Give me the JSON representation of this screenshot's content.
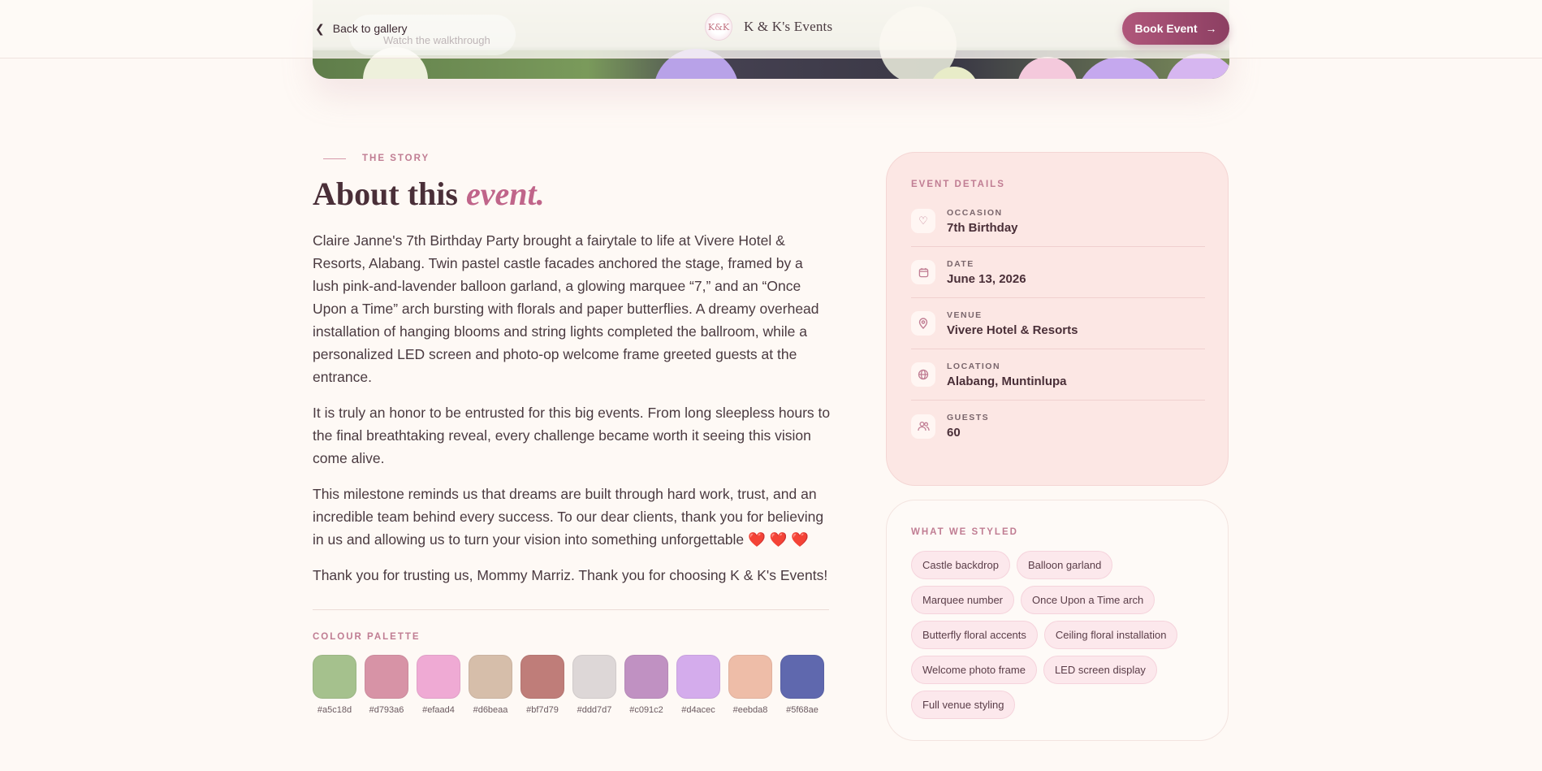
{
  "header": {
    "back_label": "Back to gallery",
    "ghost_search": "Watch the walkthrough",
    "brand_name": "K & K's Events",
    "brand_logo_text": "K&K",
    "book_label": "Book Event"
  },
  "story": {
    "eyebrow": "THE STORY",
    "title_main": "About this ",
    "title_em": "event.",
    "paragraphs": [
      "Claire Janne's 7th Birthday Party brought a fairytale to life at Vivere Hotel & Resorts, Alabang. Twin pastel castle facades anchored the stage, framed by a lush pink-and-lavender balloon garland, a glowing marquee “7,” and an “Once Upon a Time” arch bursting with florals and paper butterflies. A dreamy overhead installation of hanging blooms and string lights completed the ballroom, while a personalized LED screen and photo-op welcome frame greeted guests at the entrance.",
      "It is truly an honor to be entrusted for this big events. From long sleepless hours to the final breathtaking reveal, every challenge became worth it seeing this vision come alive.",
      "This milestone reminds us that dreams are built through hard work, trust, and an incredible team behind every success. To our dear clients, thank you for believing in us and allowing us to turn your vision into something unforgettable ❤️ ❤️ ❤️",
      "Thank you for trusting us, Mommy Marriz. Thank you for choosing K & K's Events!"
    ]
  },
  "palette": {
    "label": "COLOUR PALETTE",
    "colors": [
      "#a5c18d",
      "#d793a6",
      "#efaad4",
      "#d6beaa",
      "#bf7d79",
      "#ddd7d7",
      "#c091c2",
      "#d4acec",
      "#eebda8",
      "#5f68ae"
    ]
  },
  "details": {
    "label": "EVENT DETAILS",
    "rows": [
      {
        "key": "OCCASION",
        "value": "7th Birthday",
        "icon": "heart-icon"
      },
      {
        "key": "DATE",
        "value": "June 13, 2026",
        "icon": "calendar-icon"
      },
      {
        "key": "VENUE",
        "value": "Vivere Hotel & Resorts",
        "icon": "map-pin-icon"
      },
      {
        "key": "LOCATION",
        "value": "Alabang, Muntinlupa",
        "icon": "globe-icon"
      },
      {
        "key": "GUESTS",
        "value": "60",
        "icon": "users-icon"
      }
    ]
  },
  "styled": {
    "label": "WHAT WE STYLED",
    "tags": [
      "Castle backdrop",
      "Balloon garland",
      "Marquee number",
      "Once Upon a Time arch",
      "Butterfly floral accents",
      "Ceiling floral installation",
      "Welcome photo frame",
      "LED screen display",
      "Full venue styling"
    ]
  },
  "colors": {
    "accent": "#c0658a",
    "button": "#8c3f62",
    "background": "#fef9f5",
    "card": "#fce7e4"
  }
}
